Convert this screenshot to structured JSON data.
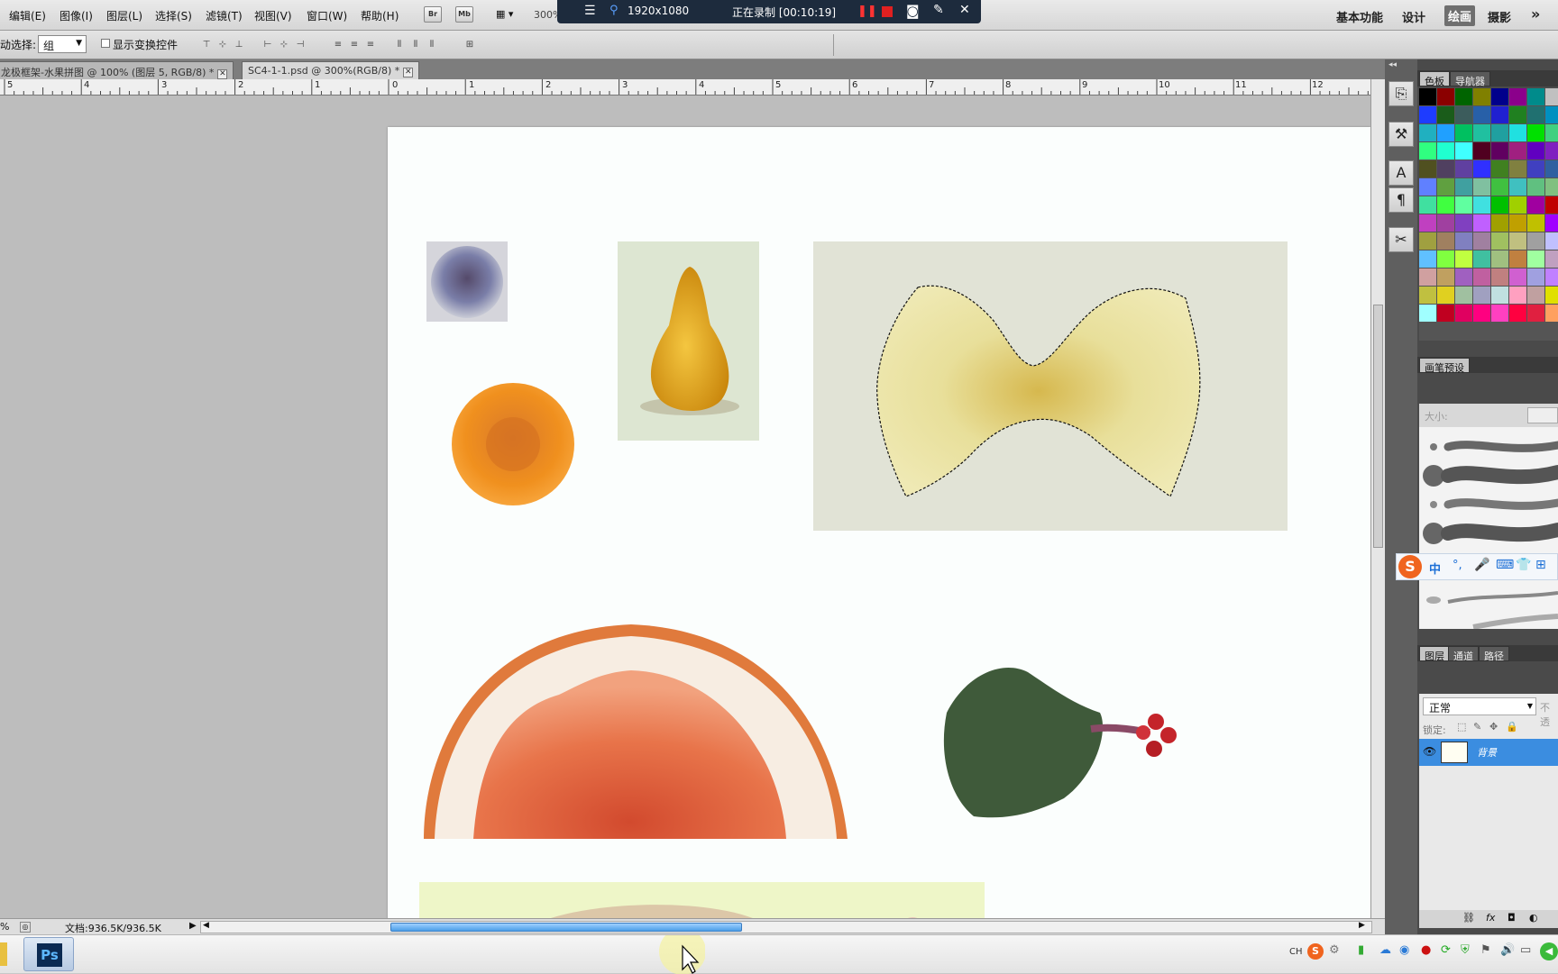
{
  "menu": {
    "items": [
      "编辑(E)",
      "图像(I)",
      "图层(L)",
      "选择(S)",
      "滤镜(T)",
      "视图(V)",
      "窗口(W)",
      "帮助(H)"
    ],
    "toolbar_badges": [
      "Br",
      "Mb"
    ],
    "zoom": "300%"
  },
  "recording": {
    "resolution": "1920x1080",
    "status": "正在录制 [00:10:19]"
  },
  "workspaces": {
    "basic": "基本功能",
    "design": "设计",
    "painting": "绘画",
    "photography": "摄影",
    "more": "»"
  },
  "options": {
    "auto_select_label": "动选择:",
    "auto_select_value": "组",
    "show_transform_label": "显示变换控件"
  },
  "tabs": [
    {
      "label": "龙极框架-水果拼图 @ 100% (图层 5, RGB/8) *",
      "active": false
    },
    {
      "label": "SC4-1-1.psd @ 300%(RGB/8) *",
      "active": true
    }
  ],
  "ruler": {
    "labels": [
      "5",
      "4",
      "3",
      "2",
      "1",
      "0",
      "1",
      "2",
      "3",
      "4",
      "5",
      "6",
      "7",
      "8",
      "9",
      "10",
      "11",
      "12"
    ]
  },
  "status": {
    "zoom": "%",
    "doc_size": "文档:936.5K/936.5K"
  },
  "panels": {
    "color_tabs": [
      "色板",
      "导航器"
    ],
    "brush_tab": "画笔预设",
    "brush_size_label": "大小:",
    "layer_tabs": [
      "图层",
      "通道",
      "路径"
    ],
    "blend_mode": "正常",
    "opacity_label": "不透",
    "lock_label": "锁定:",
    "layer_name": "背景"
  },
  "ime": {
    "label": "中"
  },
  "taskbar": {
    "ps_label": "Ps",
    "lang": "CH"
  },
  "swatch_colors": [
    "#000000",
    "#8b0000",
    "#006400",
    "#808000",
    "#00008b",
    "#8b008b",
    "#008b8b",
    "#c0c0c0",
    "#1e3cff",
    "#1a5c1a",
    "#3c5c5c",
    "#2860a8",
    "#2020d0",
    "#208020",
    "#207070",
    "#0090c0",
    "#20b0c0",
    "#20a0ff",
    "#00c060",
    "#20c0a0",
    "#20a0a0",
    "#20e0e0",
    "#00e000",
    "#40d080",
    "#30ff80",
    "#20ffd0",
    "#40ffff",
    "#500020",
    "#600060",
    "#a02080",
    "#6000c0",
    "#8020c0",
    "#505020",
    "#504060",
    "#6040a0",
    "#3030ff",
    "#408020",
    "#808040",
    "#4040c0",
    "#3060a0",
    "#6080ff",
    "#60a040",
    "#40a0a0",
    "#80c0a0",
    "#40c040",
    "#40c0c0",
    "#60c080",
    "#80c080",
    "#40e0a0",
    "#40ff40",
    "#60ffa0",
    "#40e0e0",
    "#00c000",
    "#a0d000",
    "#a000a0",
    "#c00000",
    "#c040c0",
    "#a040a0",
    "#8040c0",
    "#c060ff",
    "#a0a000",
    "#c0a000",
    "#c0c000",
    "#a000ff",
    "#a0a040",
    "#a08060",
    "#8080c0",
    "#a080a0",
    "#a0c060",
    "#c0c080",
    "#a0a0a0",
    "#c0c0ff",
    "#60c0ff",
    "#80ff40",
    "#c0ff40",
    "#40c0a0",
    "#a0c080",
    "#c08040",
    "#a0ffa0",
    "#c0a0c0",
    "#d0a0a0",
    "#c0a060",
    "#a060c0",
    "#c060a0",
    "#c08080",
    "#d060d0",
    "#a0a0e0",
    "#c080ff",
    "#c0c040",
    "#e0d020",
    "#a0c0a0",
    "#a0a0c0",
    "#c0e0e0",
    "#ffa0c0",
    "#c0a0a0",
    "#e0e000",
    "#a0ffff",
    "#c00020",
    "#e00060",
    "#ff0080",
    "#ff40c0",
    "#ff0040",
    "#e02040",
    "#ffa060"
  ]
}
